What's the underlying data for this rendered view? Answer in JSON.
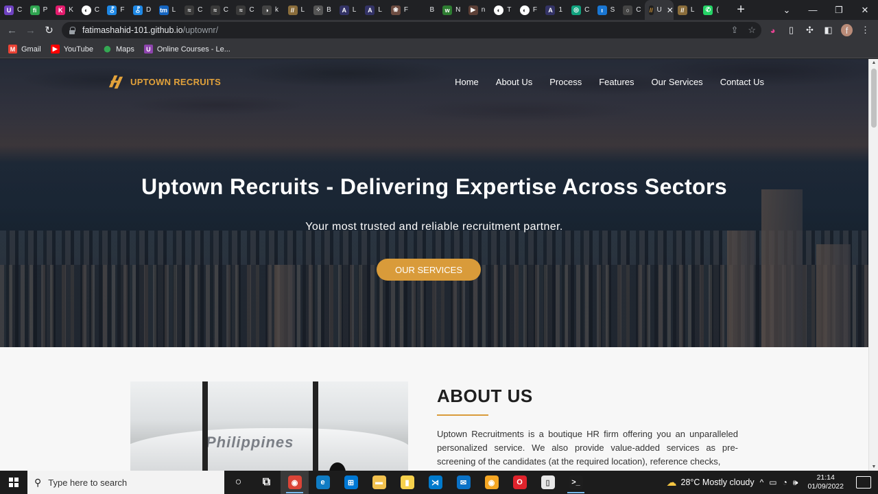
{
  "browser": {
    "tabs": [
      {
        "letter": "C",
        "color": "#6f42c1",
        "glyph": "U"
      },
      {
        "letter": "P",
        "color": "#2ea44f",
        "glyph": "fi"
      },
      {
        "letter": "K",
        "color": "#e31b6d",
        "glyph": "K"
      },
      {
        "letter": "C",
        "color": "#ffffff",
        "glyph": "◐"
      },
      {
        "letter": "F",
        "color": "#1e88e5",
        "glyph": "⯛"
      },
      {
        "letter": "D",
        "color": "#1e88e5",
        "glyph": "⯛"
      },
      {
        "letter": "L",
        "color": "#1565c0",
        "glyph": "tm"
      },
      {
        "letter": "C",
        "color": "#3a3a3a",
        "glyph": "≈"
      },
      {
        "letter": "C",
        "color": "#3a3a3a",
        "glyph": "≈"
      },
      {
        "letter": "C",
        "color": "#3a3a3a",
        "glyph": "≈"
      },
      {
        "letter": "k",
        "color": "#444444",
        "glyph": "◑"
      },
      {
        "letter": "L",
        "color": "#8a6d3b",
        "glyph": "//"
      },
      {
        "letter": "B",
        "color": "#555555",
        "glyph": "⁘"
      },
      {
        "letter": "L",
        "color": "#333366",
        "glyph": "A"
      },
      {
        "letter": "L",
        "color": "#333366",
        "glyph": "A"
      },
      {
        "letter": "F",
        "color": "#6d4c41",
        "glyph": "❀"
      },
      {
        "letter": "B",
        "color": "#202124",
        "glyph": ""
      },
      {
        "letter": "N",
        "color": "#2e7d32",
        "glyph": "w"
      },
      {
        "letter": "n",
        "color": "#5d4037",
        "glyph": "▶"
      },
      {
        "letter": "T",
        "color": "#ffffff",
        "glyph": "◐"
      },
      {
        "letter": "F",
        "color": "#ffffff",
        "glyph": "◐"
      },
      {
        "letter": "1",
        "color": "#333366",
        "glyph": "A"
      },
      {
        "letter": "C",
        "color": "#10a37f",
        "glyph": "◎"
      },
      {
        "letter": "S",
        "color": "#1976d2",
        "glyph": "ı"
      },
      {
        "letter": "C",
        "color": "#444444",
        "glyph": "○"
      }
    ],
    "active_tab": {
      "title": "U",
      "color": "#d99b3a"
    },
    "after_tabs": [
      {
        "letter": "L",
        "color": "#8a6d3b",
        "glyph": "//"
      },
      {
        "letter": "(",
        "color": "#25d366",
        "glyph": "✆"
      }
    ],
    "new_tab": "+",
    "window_controls": [
      "⌄",
      "—",
      "❐",
      "✕"
    ],
    "url_host": "fatimashahid-101.github.io",
    "url_path": "/uptownr/",
    "profile_initial": "f",
    "bookmarks": [
      {
        "label": "Gmail",
        "icon": "gmail-icon",
        "color": "#ea4335",
        "glyph": "M"
      },
      {
        "label": "YouTube",
        "icon": "youtube-icon",
        "color": "#ff0000",
        "glyph": "▶"
      },
      {
        "label": "Maps",
        "icon": "maps-icon",
        "color": "#34a853",
        "glyph": "⬤"
      },
      {
        "label": "Online Courses - Le...",
        "icon": "udemy-icon",
        "color": "#8e44ad",
        "glyph": "U"
      }
    ]
  },
  "site": {
    "brand": "UPTOWN RECRUITS",
    "brand_color": "#e3a23b",
    "nav": [
      "Home",
      "About Us",
      "Process",
      "Features",
      "Our Services",
      "Contact Us"
    ],
    "hero_title": "Uptown Recruits - Delivering Expertise Across Sectors",
    "hero_subtitle": "Your most trusted and reliable recruitment partner.",
    "hero_button": "OUR SERVICES",
    "accent_color": "#d99b3a",
    "about_image_text": "Philippines",
    "about_title": "ABOUT US",
    "about_text": "Uptown Recruitments is a boutique HR firm offering you an unparalleled personalized service. We also provide value-added services as pre-screening of the candidates (at the required location), reference checks,"
  },
  "taskbar": {
    "search_placeholder": "Type here to search",
    "apps": [
      {
        "name": "cortana-icon",
        "glyph": "○",
        "color": "transparent",
        "running": false,
        "active": false
      },
      {
        "name": "task-view-icon",
        "glyph": "⧉",
        "color": "transparent",
        "running": false,
        "active": false
      },
      {
        "name": "chrome-icon",
        "glyph": "◉",
        "color": "#db4437",
        "running": true,
        "active": true
      },
      {
        "name": "edge-icon",
        "glyph": "e",
        "color": "#0f7cc4",
        "running": false,
        "active": false
      },
      {
        "name": "store-icon",
        "glyph": "⊞",
        "color": "#0078d4",
        "running": false,
        "active": false
      },
      {
        "name": "file-explorer-icon",
        "glyph": "▬",
        "color": "#f2c14e",
        "running": false,
        "active": false
      },
      {
        "name": "sticky-notes-icon",
        "glyph": "▮",
        "color": "#f7d14c",
        "running": false,
        "active": false
      },
      {
        "name": "vscode-icon",
        "glyph": "⋊",
        "color": "#007acc",
        "running": false,
        "active": false
      },
      {
        "name": "mail-icon",
        "glyph": "✉",
        "color": "#0a72c7",
        "running": false,
        "active": false
      },
      {
        "name": "chrome-canary-icon",
        "glyph": "◉",
        "color": "#f5a623",
        "running": false,
        "active": false
      },
      {
        "name": "opera-icon",
        "glyph": "O",
        "color": "#e0232c",
        "running": false,
        "active": false
      },
      {
        "name": "notepad-icon",
        "glyph": "▯",
        "color": "#e8e8e8",
        "running": false,
        "active": false
      },
      {
        "name": "terminal-icon",
        "glyph": ">_",
        "color": "#1e1e1e",
        "running": true,
        "active": false
      }
    ],
    "weather": "28°C  Mostly cloudy",
    "time": "21:14",
    "date": "01/09/2022"
  }
}
